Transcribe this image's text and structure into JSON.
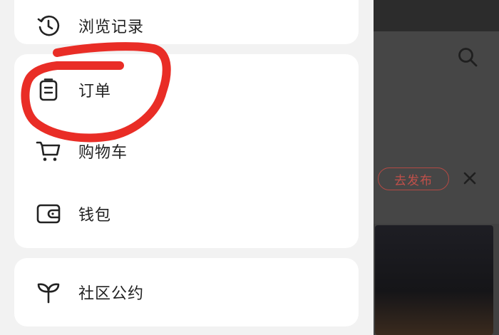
{
  "drawer": {
    "history_label": "浏览记录",
    "orders_label": "订单",
    "cart_label": "购物车",
    "wallet_label": "钱包",
    "community_label": "社区公约"
  },
  "main": {
    "publish_label": "去发布"
  },
  "icons": {
    "history": "clock-history-icon",
    "orders": "clipboard-icon",
    "cart": "cart-icon",
    "wallet": "wallet-icon",
    "community": "sprout-icon",
    "search": "search-icon",
    "close": "close-icon"
  },
  "colors": {
    "annotation": "#e8261f",
    "publish_accent": "#c0504a"
  }
}
